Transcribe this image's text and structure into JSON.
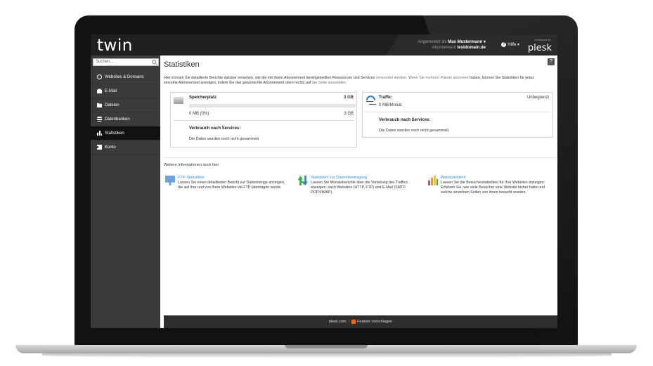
{
  "header": {
    "logo": "twin",
    "logged_in_label": "Angemeldet als",
    "user_name": "Max Mustermann ▾",
    "subscription_label": "Abonnement",
    "subscription_value": "testdomain.de",
    "help_label": "Hilfe ▾",
    "powered_by": "POWERED BY",
    "brand": "plesk"
  },
  "sidebar": {
    "search_placeholder": "Suchen...",
    "items": [
      {
        "label": "Websites & Domains",
        "icon": "globe-icon"
      },
      {
        "label": "E-Mail",
        "icon": "mail-icon"
      },
      {
        "label": "Dateien",
        "icon": "folder-icon"
      },
      {
        "label": "Datenbanken",
        "icon": "database-icon"
      },
      {
        "label": "Statistiken",
        "icon": "stats-icon",
        "active": true
      },
      {
        "label": "Konto",
        "icon": "account-icon"
      }
    ]
  },
  "main": {
    "title": "Statistiken",
    "help_button": "?",
    "intro_part1": "Hier können Sie detaillierte Berichte darüber einsehen, wie die mit Ihrem Abonnement bereitgestellten Ressourcen und Services",
    "intro_part2": "verwendet werden. Wenn Sie mehrere Pakete abonniert",
    "intro_part3": "haben, können Sie Statistiken für jedes einzelne Abonnement anzeigen, indem Sie das gewünschte Abonnement oben rechts auf",
    "intro_part4": "der Seite auswählen.",
    "space_card": {
      "title": "Speicherplatz",
      "limit": "3 GB",
      "used": "0 MB (0%)",
      "used_fraction": 0.0,
      "total": "3 GB",
      "services_title": "Verbrauch nach Services:",
      "services_text": "Die Daten wurden noch nicht gesammelt."
    },
    "traffic_card": {
      "title": "Traffic",
      "limit": "Unbegrenzt",
      "used": "0 MB/Monat",
      "services_title": "Verbrauch nach Services:",
      "services_text": "Die Daten wurden noch nicht gesammelt."
    },
    "more_info_title": "Weitere Informationen auch hier:",
    "info_items": [
      {
        "link": "FTP-Statistiken",
        "desc": "Lassen Sie einen detaillierten Bericht zur Datenmenge anzeigen, die auf Ihre und von Ihren Websites via FTP übertragen wurde.",
        "icon": "ftp-icon"
      },
      {
        "link": "Statistiken zur Datenübertragung",
        "desc": "Lassen Sie Monatsberichte über die Verteilung des Traffics anzeigen: nach Websites (HTTP, FTP) und E-Mail (SMTP, POP3/IMAP).",
        "icon": "transfer-icon"
      },
      {
        "link": "Webstatistiken",
        "desc": "Lassen Sie die Besucherstatistiken für Ihre Websites anzeigen: Erfahren Sie, wie viele Besucher eine Website bisher hatte und welche einzelnen Seiten von ihnen besucht wurden.",
        "icon": "webstats-icon"
      }
    ]
  },
  "footer": {
    "link1": "plesk.com",
    "link2": "Feature vorschlagen"
  }
}
